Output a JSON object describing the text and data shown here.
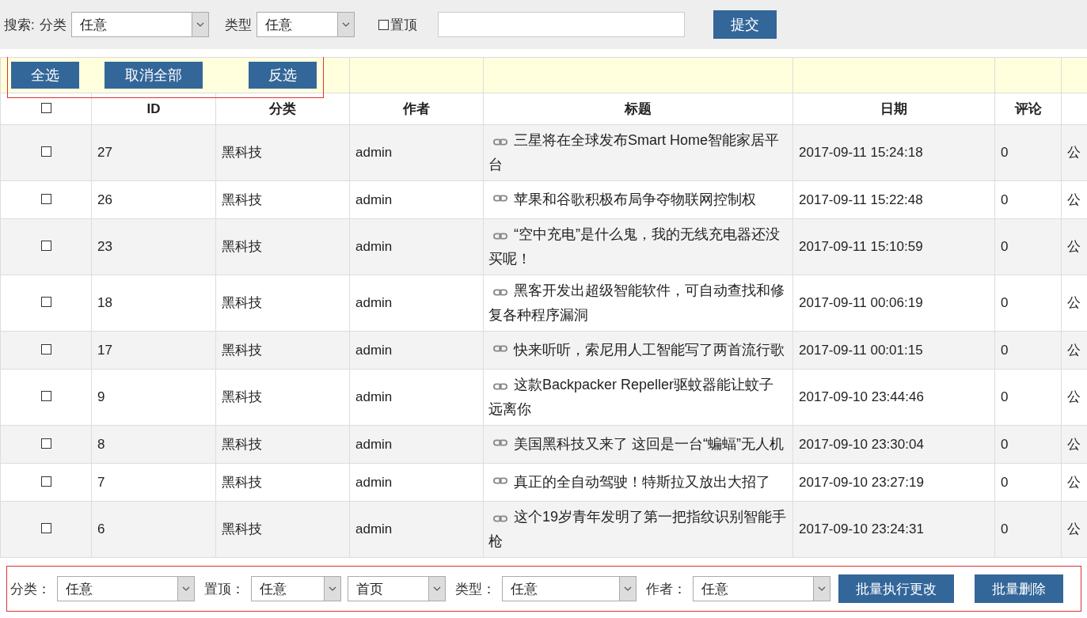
{
  "search": {
    "label": "搜索:",
    "category_label": "分类",
    "category": "任意",
    "type_label": "类型",
    "type": "任意",
    "pinned": {
      "label": "置顶",
      "checked": false
    },
    "submit": "提交"
  },
  "bulk_buttons": [
    "全选",
    "取消全部",
    "反选"
  ],
  "table": {
    "select_all_checked": false,
    "columns": [
      "ID",
      "分类",
      "作者",
      "标题",
      "日期",
      "评论"
    ],
    "rows": [
      {
        "checked": false,
        "id": "27",
        "category": "黑科技",
        "author": "admin",
        "title": "三星将在全球发布Smart Home智能家居平台",
        "date": "2017-09-11 15:24:18",
        "comments": "0",
        "column_7": "公"
      },
      {
        "checked": false,
        "id": "26",
        "category": "黑科技",
        "author": "admin",
        "title": "苹果和谷歌积极布局争夺物联网控制权",
        "date": "2017-09-11 15:22:48",
        "comments": "0",
        "column_7": "公"
      },
      {
        "checked": false,
        "id": "23",
        "category": "黑科技",
        "author": "admin",
        "title": "“空中充电”是什么鬼，我的无线充电器还没买呢！",
        "date": "2017-09-11 15:10:59",
        "comments": "0",
        "column_7": "公"
      },
      {
        "checked": false,
        "id": "18",
        "category": "黑科技",
        "author": "admin",
        "title": "黑客开发出超级智能软件，可自动查找和修复各种程序漏洞",
        "date": "2017-09-11 00:06:19",
        "comments": "0",
        "column_7": "公"
      },
      {
        "checked": false,
        "id": "17",
        "category": "黑科技",
        "author": "admin",
        "title": "快来听听，索尼用人工智能写了两首流行歌",
        "date": "2017-09-11 00:01:15",
        "comments": "0",
        "column_7": "公"
      },
      {
        "checked": false,
        "id": "9",
        "category": "黑科技",
        "author": "admin",
        "title": "这款Backpacker Repeller驱蚊器能让蚊子远离你",
        "date": "2017-09-10 23:44:46",
        "comments": "0",
        "column_7": "公"
      },
      {
        "checked": false,
        "id": "8",
        "category": "黑科技",
        "author": "admin",
        "title": "美国黑科技又来了 这回是一台“蝙蝠”无人机",
        "date": "2017-09-10 23:30:04",
        "comments": "0",
        "column_7": "公"
      },
      {
        "checked": false,
        "id": "7",
        "category": "黑科技",
        "author": "admin",
        "title": "真正的全自动驾驶！特斯拉又放出大招了",
        "date": "2017-09-10 23:27:19",
        "comments": "0",
        "column_7": "公"
      },
      {
        "checked": false,
        "id": "6",
        "category": "黑科技",
        "author": "admin",
        "title": "这个19岁青年发明了第一把指纹识别智能手枪",
        "date": "2017-09-10 23:24:31",
        "comments": "0",
        "column_7": "公"
      }
    ]
  },
  "batch": {
    "fields": [
      {
        "label": "分类：",
        "value": "任意"
      },
      {
        "label": "置顶：",
        "value": "任意"
      },
      {
        "value": "首页"
      },
      {
        "label": "类型：",
        "value": "任意"
      },
      {
        "label": "作者：",
        "value": "任意"
      }
    ],
    "buttons": [
      "批量执行更改",
      "批量删除"
    ]
  }
}
